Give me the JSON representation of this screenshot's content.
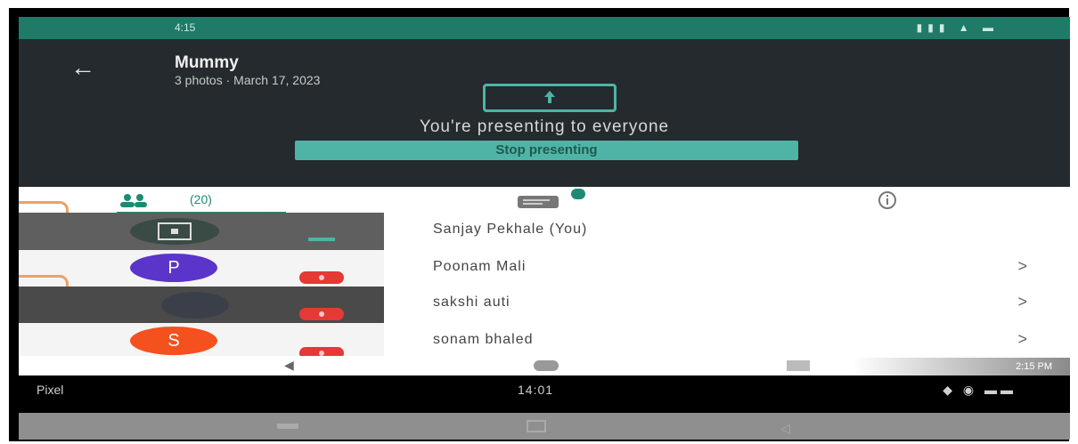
{
  "status_bar": {
    "time": "4:15",
    "icons": "wifi signal battery"
  },
  "header": {
    "back_icon": "arrow-left-icon",
    "title": "Mummy",
    "subtitle": "3 photos · March 17, 2023",
    "presenting_text": "You're presenting to everyone",
    "stop_button": "Stop presenting"
  },
  "tabs": [
    {
      "name": "people",
      "count": "(20)",
      "icon": "people-icon"
    },
    {
      "name": "chat",
      "icon": "chat-icon"
    },
    {
      "name": "info",
      "icon": "info-icon"
    }
  ],
  "tiles": [
    {
      "type": "screen-share"
    },
    {
      "initial": "P",
      "color": "#5b35c9",
      "muted": true
    },
    {
      "type": "photo",
      "muted": true
    },
    {
      "initial": "S",
      "color": "#f4511e",
      "muted": true
    }
  ],
  "participants": [
    {
      "name": "Sanjay Pekhale (You)",
      "chevron": ""
    },
    {
      "name": "Poonam Mali",
      "chevron": ">"
    },
    {
      "name": "sakshi auti",
      "chevron": ">"
    },
    {
      "name": "sonam bhaled",
      "chevron": ">"
    }
  ],
  "navbar": {
    "toast": "2:15 PM"
  },
  "host_status": {
    "label": "Pixel",
    "clock": "14:01"
  },
  "colors": {
    "accent": "#1d8b73",
    "button": "#4fb4a6",
    "header_bg": "#242a2e",
    "status_bg": "#1f7a67"
  }
}
